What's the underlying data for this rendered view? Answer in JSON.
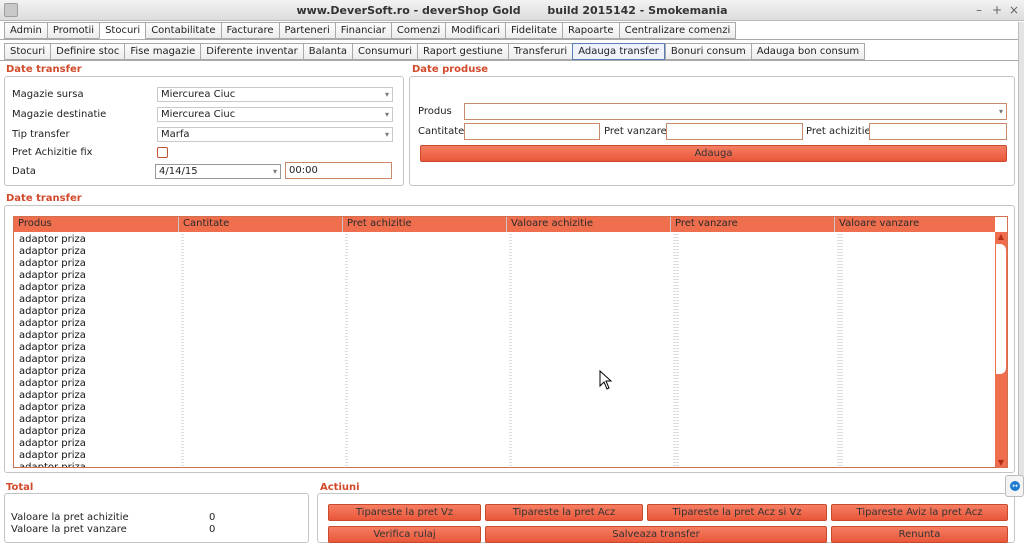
{
  "window": {
    "title": "www.DeverSoft.ro - deverShop Gold       build 2015142 - Smokemania",
    "minimize": "–",
    "maximize": "+",
    "close": "×"
  },
  "main_tabs": [
    "Admin",
    "Promotii",
    "Stocuri",
    "Contabilitate",
    "Facturare",
    "Parteneri",
    "Financiar",
    "Comenzi",
    "Modificari",
    "Fidelitate",
    "Rapoarte",
    "Centralizare comenzi"
  ],
  "main_tab_active": "Stocuri",
  "sub_tabs": [
    "Stocuri",
    "Definire stoc",
    "Fise magazie",
    "Diferente inventar",
    "Balanta",
    "Consumuri",
    "Raport gestiune",
    "Transferuri",
    "Adauga transfer",
    "Bonuri consum",
    "Adauga bon consum"
  ],
  "sub_tab_active": "Adauga transfer",
  "transfer_form": {
    "section_title": "Date transfer",
    "magazie_sursa_label": "Magazie sursa",
    "magazie_sursa_value": "Miercurea Ciuc",
    "magazie_destinatie_label": "Magazie destinatie",
    "magazie_destinatie_value": "Miercurea Ciuc",
    "tip_transfer_label": "Tip transfer",
    "tip_transfer_value": "Marfa",
    "pret_achizitie_fix_label": "Pret Achizitie fix",
    "pret_achizitie_fix_checked": false,
    "data_label": "Data",
    "data_date_value": "4/14/15",
    "data_time_value": "00:00"
  },
  "product_form": {
    "section_title": "Date produse",
    "produs_label": "Produs",
    "produs_value": "",
    "cantitate_label": "Cantitate",
    "cantitate_value": "",
    "pret_vanzare_label": "Pret vanzare",
    "pret_vanzare_value": "",
    "pret_achizitie_label": "Pret achizitie",
    "pret_achizitie_value": "",
    "add_button": "Adauga"
  },
  "grid": {
    "section_title": "Date transfer",
    "columns": [
      "Produs",
      "Cantitate",
      "Pret achizitie",
      "Valoare achizitie",
      "Pret vanzare",
      "Valoare vanzare"
    ],
    "rows": [
      "adaptor priza",
      "adaptor priza",
      "adaptor priza",
      "adaptor priza",
      "adaptor priza",
      "adaptor priza",
      "adaptor priza",
      "adaptor priza",
      "adaptor priza",
      "adaptor priza",
      "adaptor priza",
      "adaptor priza",
      "adaptor priza",
      "adaptor priza",
      "adaptor priza",
      "adaptor priza",
      "adaptor priza",
      "adaptor priza",
      "adaptor priza",
      "adaptor priza"
    ],
    "scroll_up": "▲",
    "scroll_down": "▼"
  },
  "total": {
    "section_title": "Total",
    "valoare_achizitie_label": "Valoare la pret achizitie",
    "valoare_achizitie_value": "0",
    "valoare_vanzare_label": "Valoare la pret vanzare",
    "valoare_vanzare_value": "0"
  },
  "actions": {
    "section_title": "Actiuni",
    "print_vz": "Tipareste la pret Vz",
    "print_acz": "Tipareste la pret Acz",
    "print_acz_vz": "Tipareste la pret Acz si Vz",
    "print_aviz_acz": "Tipareste Aviz la pret Acz",
    "verifica_rulaj": "Verifica rulaj",
    "salveaza_transfer": "Salveaza transfer",
    "renunta": "Renunta"
  },
  "colors": {
    "accent": "#ee6e4e",
    "button": "#f07052",
    "section_label": "#d24a2b"
  }
}
